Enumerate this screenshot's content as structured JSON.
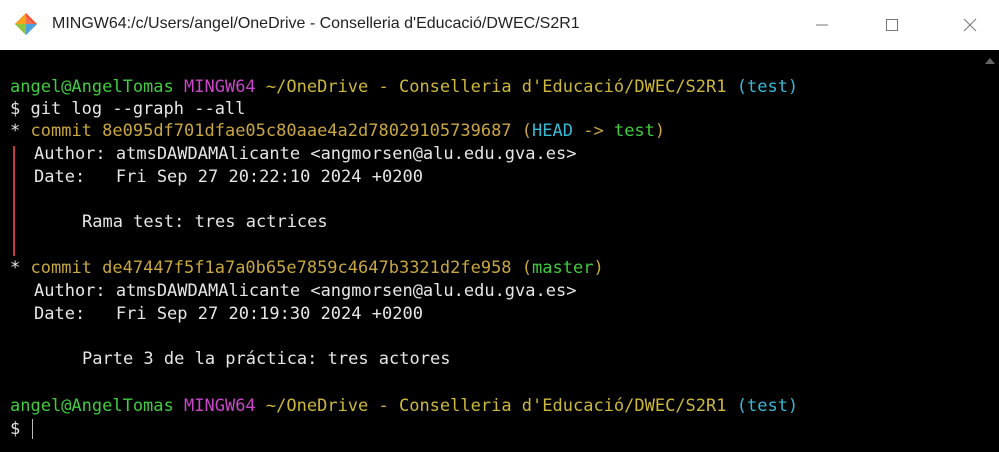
{
  "window": {
    "title": "MINGW64:/c/Users/angel/OneDrive - Conselleria d'Educació/DWEC/S2R1",
    "icon": "git-bash-icon"
  },
  "terminal": {
    "prompt1": {
      "userhost": "angel@AngelTomas",
      "shell": "MINGW64",
      "path": "~/OneDrive - Conselleria d'Educació/DWEC/S2R1",
      "branch": "(test)"
    },
    "cmd_line": "$ git log --graph --all",
    "commits": [
      {
        "graph": "*",
        "hash_line": "commit 8e095df701dfae05c80aae4a2d78029105739687",
        "ref_open": "(",
        "head": "HEAD",
        "arrow": " -> ",
        "branch": "test",
        "ref_close": ")",
        "author": "Author: atmsDAWDAMAlicante <angmorsen@alu.edu.gva.es>",
        "date": "Date:   Fri Sep 27 20:22:10 2024 +0200",
        "message": "Rama test: tres actrices"
      },
      {
        "graph": "*",
        "hash_line": "commit de47447f5f1a7a0b65e7859c4647b3321d2fe958",
        "ref_open": "(",
        "branch": "master",
        "ref_close": ")",
        "author": "Author: atmsDAWDAMAlicante <angmorsen@alu.edu.gva.es>",
        "date": "Date:   Fri Sep 27 20:19:30 2024 +0200",
        "message": "Parte 3 de la práctica: tres actores"
      }
    ],
    "prompt2": {
      "userhost": "angel@AngelTomas",
      "shell": "MINGW64",
      "path": "~/OneDrive - Conselleria d'Educació/DWEC/S2R1",
      "branch": "(test)"
    },
    "final_prompt": "$"
  },
  "colors": {
    "userhost": "#3fcc3f",
    "shell": "#c846c8",
    "path": "#cdb83a",
    "branch": "#36b9d6",
    "graph_line": "#c23a3a"
  }
}
